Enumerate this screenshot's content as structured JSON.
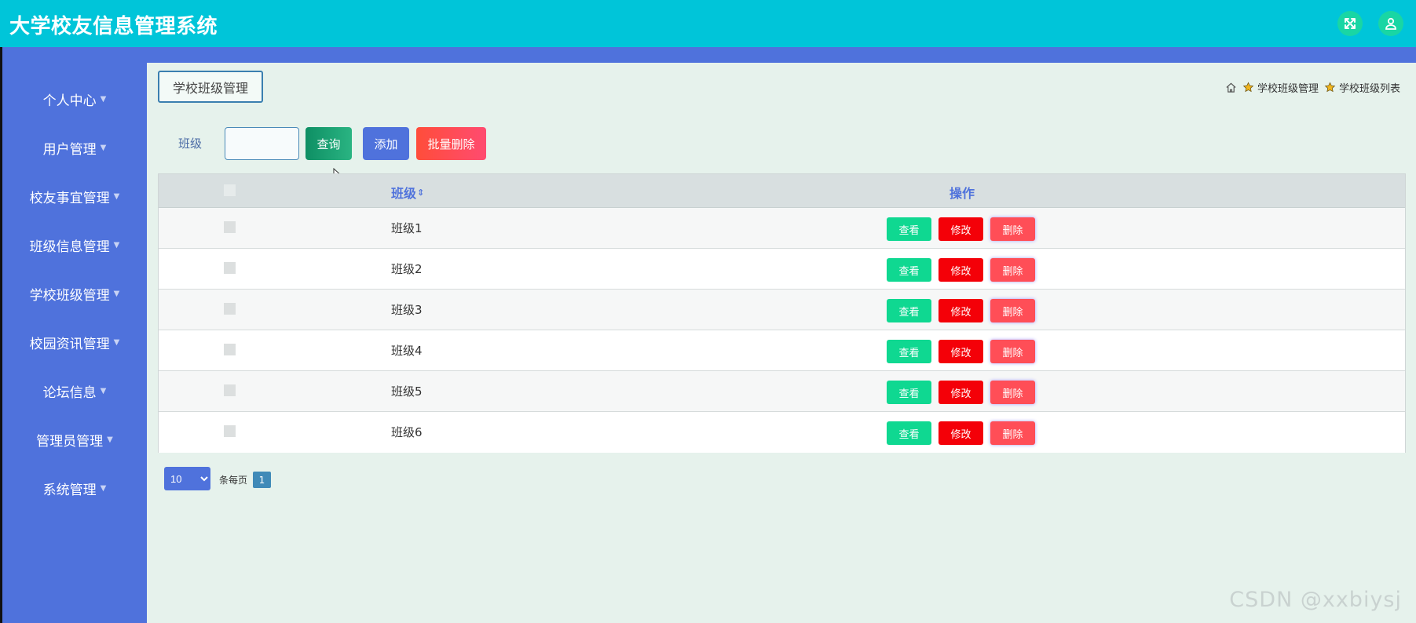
{
  "header": {
    "app_title": "大学校友信息管理系统",
    "icons": [
      "fullscreen-icon",
      "user-icon"
    ],
    "colors": {
      "topbar": "#00c5d9",
      "sidebar": "#4f72dc",
      "icon_bg": "#19d6a4"
    }
  },
  "sidebar": {
    "items": [
      {
        "label": "个人中心"
      },
      {
        "label": "用户管理"
      },
      {
        "label": "校友事宜管理"
      },
      {
        "label": "班级信息管理"
      },
      {
        "label": "学校班级管理"
      },
      {
        "label": "校园资讯管理"
      },
      {
        "label": "论坛信息"
      },
      {
        "label": "管理员管理"
      },
      {
        "label": "系统管理"
      }
    ]
  },
  "page": {
    "title": "学校班级管理",
    "breadcrumb": [
      "学校班级管理",
      "学校班级列表"
    ]
  },
  "filter": {
    "label": "班级",
    "value": "",
    "search_label": "查询",
    "add_label": "添加",
    "batch_delete_label": "批量删除"
  },
  "table": {
    "columns": {
      "name": "班级",
      "ops": "操作"
    },
    "rows": [
      {
        "name": "班级1"
      },
      {
        "name": "班级2"
      },
      {
        "name": "班级3"
      },
      {
        "name": "班级4"
      },
      {
        "name": "班级5"
      },
      {
        "name": "班级6"
      }
    ],
    "row_actions": {
      "view": "查看",
      "edit": "修改",
      "delete": "删除"
    }
  },
  "pagination": {
    "page_size": "10",
    "page_size_options": [
      "10"
    ],
    "per_page_text": "条每页",
    "current_page": "1"
  },
  "watermark": "CSDN @xxbiysj"
}
